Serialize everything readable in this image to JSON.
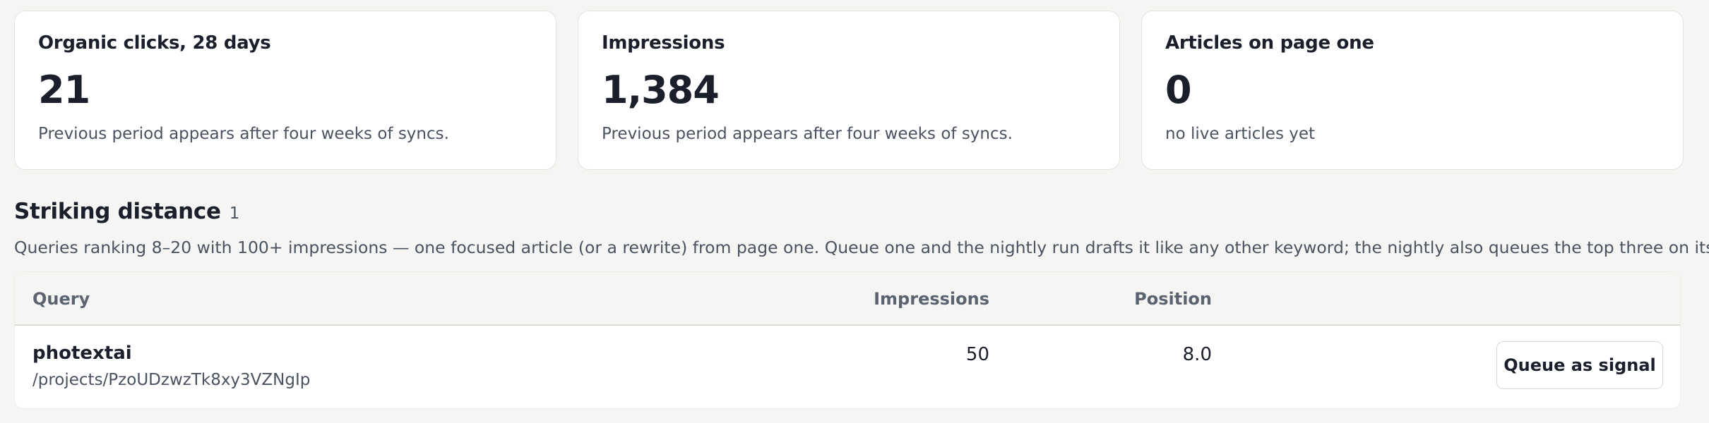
{
  "stats": [
    {
      "title": "Organic clicks, 28 days",
      "value": "21",
      "note": "Previous period appears after four weeks of syncs."
    },
    {
      "title": "Impressions",
      "value": "1,384",
      "note": "Previous period appears after four weeks of syncs."
    },
    {
      "title": "Articles on page one",
      "value": "0",
      "note": "no live articles yet"
    }
  ],
  "striking": {
    "title": "Striking distance",
    "count": "1",
    "description": "Queries ranking 8–20 with 100+ impressions — one focused article (or a rewrite) from page one. Queue one and the nightly run drafts it like any other keyword; the nightly also queues the top three on its own.",
    "columns": {
      "query": "Query",
      "impressions": "Impressions",
      "position": "Position"
    },
    "rows": [
      {
        "query": "photextai",
        "path": "/projects/PzoUDzwzTk8xy3VZNgIp",
        "impressions": "50",
        "position": "8.0",
        "action_label": "Queue as signal"
      }
    ]
  }
}
